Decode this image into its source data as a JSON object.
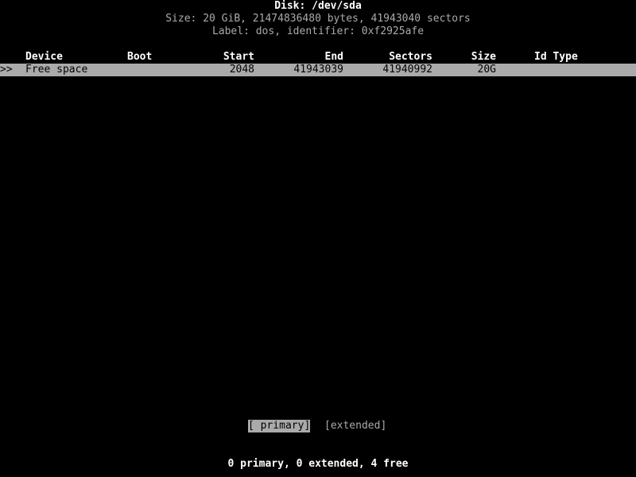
{
  "header": {
    "disk_title": "Disk: /dev/sda",
    "size_line": "Size: 20 GiB, 21474836480 bytes, 41943040 sectors",
    "label_line": "Label: dos, identifier: 0xf2925afe"
  },
  "table": {
    "columns": {
      "device": "Device",
      "boot": "Boot",
      "start": "Start",
      "end": "End",
      "sectors": "Sectors",
      "size": "Size",
      "id_type": "Id Type"
    },
    "rows": [
      {
        "selected": true,
        "marker": ">>",
        "device": "Free space",
        "boot": "",
        "start": "2048",
        "end": "41943039",
        "sectors": "41940992",
        "size": "20G",
        "id_type": ""
      }
    ]
  },
  "actions": {
    "primary": "[ primary]",
    "extended": "[extended]"
  },
  "status": "0 primary, 0 extended, 4 free"
}
